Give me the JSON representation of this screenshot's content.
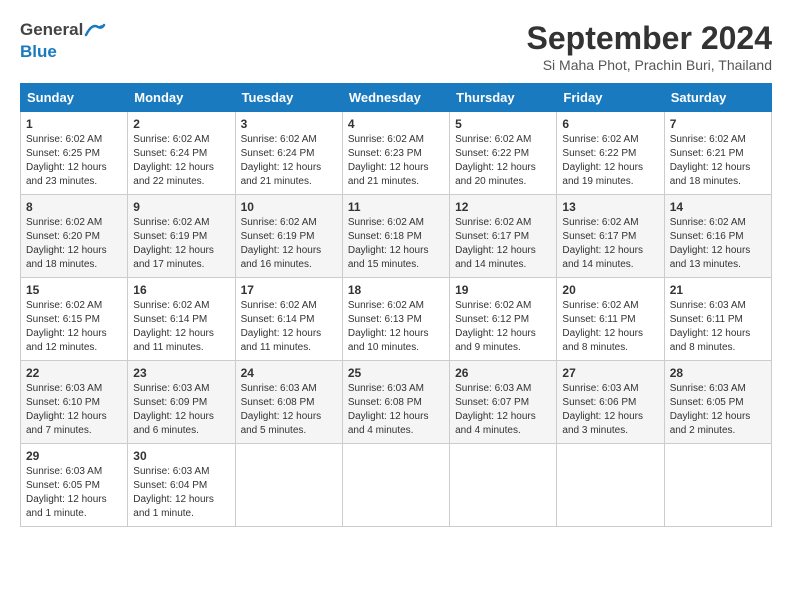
{
  "header": {
    "logo_general": "General",
    "logo_blue": "Blue",
    "month": "September 2024",
    "location": "Si Maha Phot, Prachin Buri, Thailand"
  },
  "days_of_week": [
    "Sunday",
    "Monday",
    "Tuesday",
    "Wednesday",
    "Thursday",
    "Friday",
    "Saturday"
  ],
  "weeks": [
    [
      {
        "day": "1",
        "rise": "6:02 AM",
        "set": "6:25 PM",
        "hours": "12 hours and 23 minutes"
      },
      {
        "day": "2",
        "rise": "6:02 AM",
        "set": "6:24 PM",
        "hours": "12 hours and 22 minutes"
      },
      {
        "day": "3",
        "rise": "6:02 AM",
        "set": "6:24 PM",
        "hours": "12 hours and 21 minutes"
      },
      {
        "day": "4",
        "rise": "6:02 AM",
        "set": "6:23 PM",
        "hours": "12 hours and 21 minutes"
      },
      {
        "day": "5",
        "rise": "6:02 AM",
        "set": "6:22 PM",
        "hours": "12 hours and 20 minutes"
      },
      {
        "day": "6",
        "rise": "6:02 AM",
        "set": "6:22 PM",
        "hours": "12 hours and 19 minutes"
      },
      {
        "day": "7",
        "rise": "6:02 AM",
        "set": "6:21 PM",
        "hours": "12 hours and 18 minutes"
      }
    ],
    [
      {
        "day": "8",
        "rise": "6:02 AM",
        "set": "6:20 PM",
        "hours": "12 hours and 18 minutes"
      },
      {
        "day": "9",
        "rise": "6:02 AM",
        "set": "6:19 PM",
        "hours": "12 hours and 17 minutes"
      },
      {
        "day": "10",
        "rise": "6:02 AM",
        "set": "6:19 PM",
        "hours": "12 hours and 16 minutes"
      },
      {
        "day": "11",
        "rise": "6:02 AM",
        "set": "6:18 PM",
        "hours": "12 hours and 15 minutes"
      },
      {
        "day": "12",
        "rise": "6:02 AM",
        "set": "6:17 PM",
        "hours": "12 hours and 14 minutes"
      },
      {
        "day": "13",
        "rise": "6:02 AM",
        "set": "6:17 PM",
        "hours": "12 hours and 14 minutes"
      },
      {
        "day": "14",
        "rise": "6:02 AM",
        "set": "6:16 PM",
        "hours": "12 hours and 13 minutes"
      }
    ],
    [
      {
        "day": "15",
        "rise": "6:02 AM",
        "set": "6:15 PM",
        "hours": "12 hours and 12 minutes"
      },
      {
        "day": "16",
        "rise": "6:02 AM",
        "set": "6:14 PM",
        "hours": "12 hours and 11 minutes"
      },
      {
        "day": "17",
        "rise": "6:02 AM",
        "set": "6:14 PM",
        "hours": "12 hours and 11 minutes"
      },
      {
        "day": "18",
        "rise": "6:02 AM",
        "set": "6:13 PM",
        "hours": "12 hours and 10 minutes"
      },
      {
        "day": "19",
        "rise": "6:02 AM",
        "set": "6:12 PM",
        "hours": "12 hours and 9 minutes"
      },
      {
        "day": "20",
        "rise": "6:02 AM",
        "set": "6:11 PM",
        "hours": "12 hours and 8 minutes"
      },
      {
        "day": "21",
        "rise": "6:03 AM",
        "set": "6:11 PM",
        "hours": "12 hours and 8 minutes"
      }
    ],
    [
      {
        "day": "22",
        "rise": "6:03 AM",
        "set": "6:10 PM",
        "hours": "12 hours and 7 minutes"
      },
      {
        "day": "23",
        "rise": "6:03 AM",
        "set": "6:09 PM",
        "hours": "12 hours and 6 minutes"
      },
      {
        "day": "24",
        "rise": "6:03 AM",
        "set": "6:08 PM",
        "hours": "12 hours and 5 minutes"
      },
      {
        "day": "25",
        "rise": "6:03 AM",
        "set": "6:08 PM",
        "hours": "12 hours and 4 minutes"
      },
      {
        "day": "26",
        "rise": "6:03 AM",
        "set": "6:07 PM",
        "hours": "12 hours and 4 minutes"
      },
      {
        "day": "27",
        "rise": "6:03 AM",
        "set": "6:06 PM",
        "hours": "12 hours and 3 minutes"
      },
      {
        "day": "28",
        "rise": "6:03 AM",
        "set": "6:05 PM",
        "hours": "12 hours and 2 minutes"
      }
    ],
    [
      {
        "day": "29",
        "rise": "6:03 AM",
        "set": "6:05 PM",
        "hours": "12 hours and 1 minute"
      },
      {
        "day": "30",
        "rise": "6:03 AM",
        "set": "6:04 PM",
        "hours": "12 hours and 1 minute"
      },
      null,
      null,
      null,
      null,
      null
    ]
  ],
  "labels": {
    "sunrise": "Sunrise:",
    "sunset": "Sunset:",
    "daylight": "Daylight:"
  }
}
